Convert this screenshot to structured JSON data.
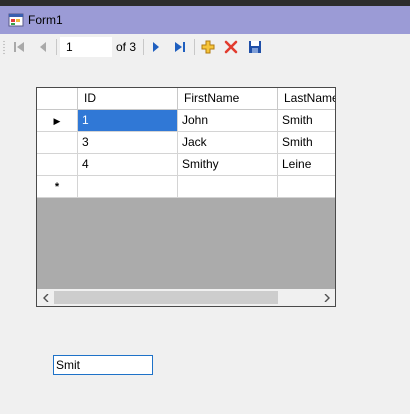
{
  "window": {
    "title": "Form1",
    "titlebar_color": "#9b9bd6"
  },
  "navigator": {
    "position": "1",
    "count_label": "of 3",
    "buttons": [
      "move-first-icon",
      "move-previous-icon",
      "move-next-icon",
      "move-last-icon",
      "add-new-icon",
      "delete-icon",
      "save-icon"
    ]
  },
  "grid": {
    "columns": [
      "ID",
      "FirstName",
      "LastName"
    ],
    "rows": [
      {
        "id": "1",
        "first": "John",
        "last": "Smith"
      },
      {
        "id": "3",
        "first": "Jack",
        "last": "Smith"
      },
      {
        "id": "4",
        "first": "Smithy",
        "last": "Leine"
      }
    ],
    "current_row_indicator": "▶",
    "new_row_indicator": "*",
    "selection_color": "#3078d6"
  },
  "search_box": {
    "value": "Smit"
  }
}
